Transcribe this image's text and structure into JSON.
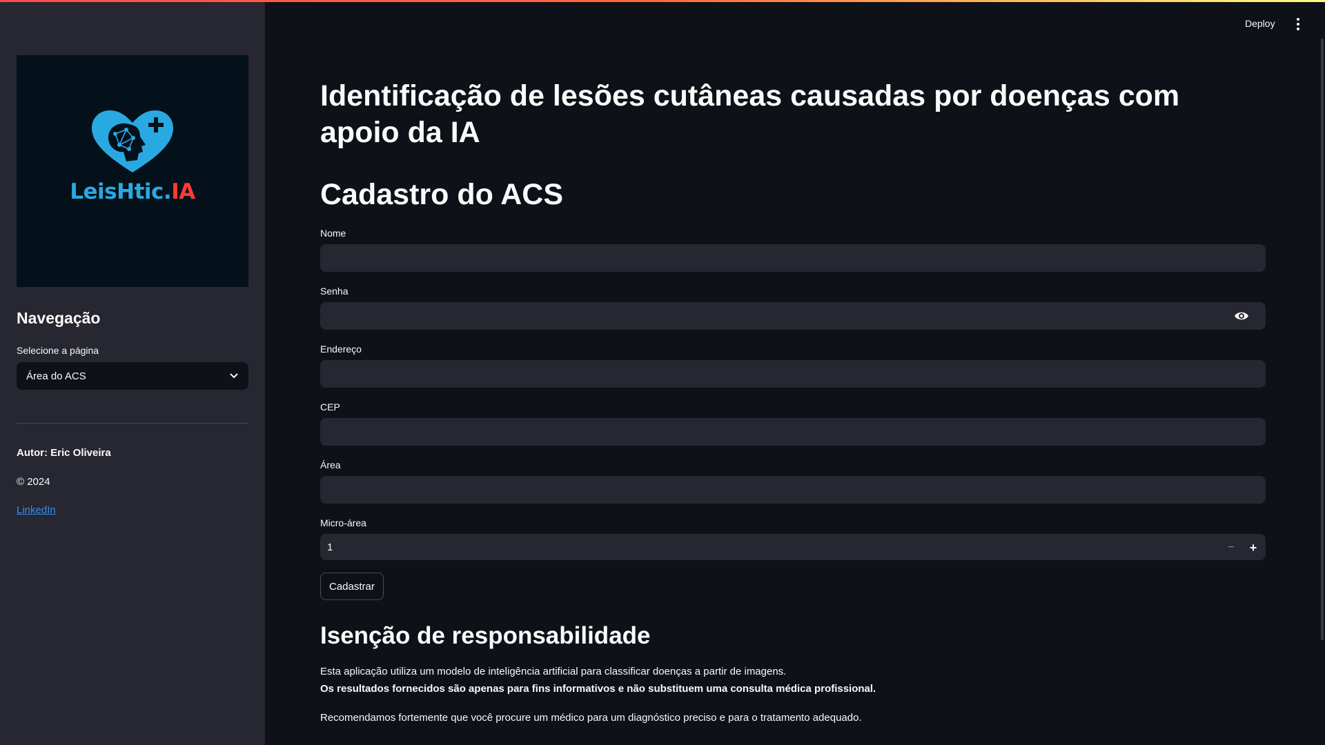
{
  "colors": {
    "accent": "#ff4b4b",
    "background": "#0e1117",
    "sidebar": "#262730",
    "input": "#262730",
    "link": "#3b8eea",
    "logo_blue": "#29a9e1",
    "logo_red": "#ff3b30"
  },
  "header": {
    "deploy_label": "Deploy",
    "menu_icon": "vertical-dots-icon"
  },
  "sidebar": {
    "logo": {
      "text_main": "LeisHtic.",
      "text_accent": "IA",
      "icon": "heart-brain-medical-icon"
    },
    "nav_title": "Navegação",
    "select_label": "Selecione a página",
    "select_value": "Área do ACS",
    "author": "Autor: Eric Oliveira",
    "copyright": "© 2024",
    "link": "LinkedIn"
  },
  "main": {
    "title": "Identificação de lesões cutâneas causadas por doenças com apoio da IA",
    "form_title": "Cadastro do ACS",
    "fields": {
      "nome": {
        "label": "Nome",
        "value": ""
      },
      "senha": {
        "label": "Senha",
        "value": ""
      },
      "endereco": {
        "label": "Endereço",
        "value": ""
      },
      "cep": {
        "label": "CEP",
        "value": ""
      },
      "area": {
        "label": "Área",
        "value": ""
      },
      "microarea": {
        "label": "Micro-área",
        "value": "1",
        "minus": "−",
        "plus": "+"
      }
    },
    "submit_label": "Cadastrar",
    "disclaimer": {
      "title": "Isenção de responsabilidade",
      "p1": "Esta aplicação utiliza um modelo de inteligência artificial para classificar doenças a partir de imagens.",
      "p2": "Os resultados fornecidos são apenas para fins informativos e não substituem uma consulta médica profissional.",
      "p3": "Recomendamos fortemente que você procure um médico para um diagnóstico preciso e para o tratamento adequado."
    }
  }
}
